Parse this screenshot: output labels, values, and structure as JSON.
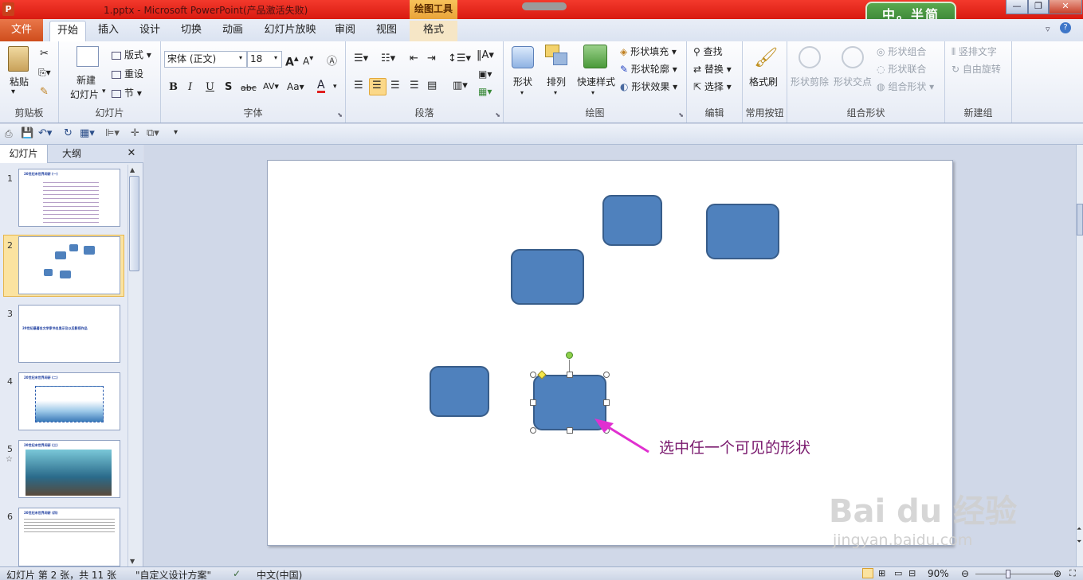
{
  "window": {
    "title": "1.pptx - Microsoft PowerPoint(产品激活失败)",
    "context_tool_header": "绘图工具",
    "controls": [
      "—",
      "❐",
      "✕"
    ]
  },
  "logo_badge": "中。半简",
  "tabs": {
    "file": "文件",
    "items": [
      "开始",
      "插入",
      "设计",
      "切换",
      "动画",
      "幻灯片放映",
      "审阅",
      "视图",
      "格式"
    ],
    "active": "开始"
  },
  "ribbon": {
    "clipboard": {
      "paste": "粘贴",
      "label": "剪贴板"
    },
    "slides": {
      "new_slide": "新建\n幻灯片",
      "new_slide_line1": "新建",
      "new_slide_line2": "幻灯片",
      "layout": "版式",
      "reset": "重设",
      "section": "节",
      "label": "幻灯片"
    },
    "font": {
      "font_name": "宋体 (正文)",
      "font_size": "18",
      "label": "字体"
    },
    "paragraph": {
      "label": "段落"
    },
    "drawing": {
      "shapes": "形状",
      "arrange": "排列",
      "quick_styles": "快速样式",
      "shape_fill": "形状填充",
      "shape_outline": "形状轮廓",
      "shape_effects": "形状效果",
      "label": "绘图"
    },
    "editing": {
      "find": "查找",
      "replace": "替换",
      "select": "选择",
      "label": "编辑"
    },
    "common": {
      "format_painter": "格式刷",
      "label": "常用按钮"
    },
    "combine": {
      "shape_subtract": "形状剪除",
      "shape_intersect": "形状交点",
      "shape_union": "形状组合",
      "shape_combine": "形状联合",
      "combine_shapes": "组合形状",
      "label": "组合形状"
    },
    "newgroup": {
      "vertical_text": "竖排文字",
      "auto_rotate": "自由旋转",
      "label": "新建组"
    }
  },
  "panel": {
    "tab_slides": "幻灯片",
    "tab_outline": "大纲",
    "close": "✕",
    "slides": [
      {
        "num": "1",
        "title": "20世纪末世界间研 (一)"
      },
      {
        "num": "2",
        "title": ""
      },
      {
        "num": "3",
        "title": "20世纪最著名文学家书名显示及以后影视作品"
      },
      {
        "num": "4",
        "title": "20世纪末世界间研 (二)"
      },
      {
        "num": "5",
        "title": "20世纪末世界间研 (三)"
      },
      {
        "num": "6",
        "title": "20世纪末世界间研 (四)"
      }
    ]
  },
  "annotation": "选中任一个可见的形状",
  "watermark": {
    "main": "Bai du 经验",
    "sub": "jingyan.baidu.com"
  },
  "statusbar": {
    "slide_info": "幻灯片 第 2 张，共 11 张",
    "theme": "\"自定义设计方案\"",
    "language": "中文(中国)",
    "zoom": "90%"
  },
  "colors": {
    "shape_fill": "#4f81bd",
    "shape_border": "#385d8a",
    "title_bar": "#e02a1e",
    "file_tab": "#d85a2a",
    "annotation": "#7a1a6e"
  }
}
